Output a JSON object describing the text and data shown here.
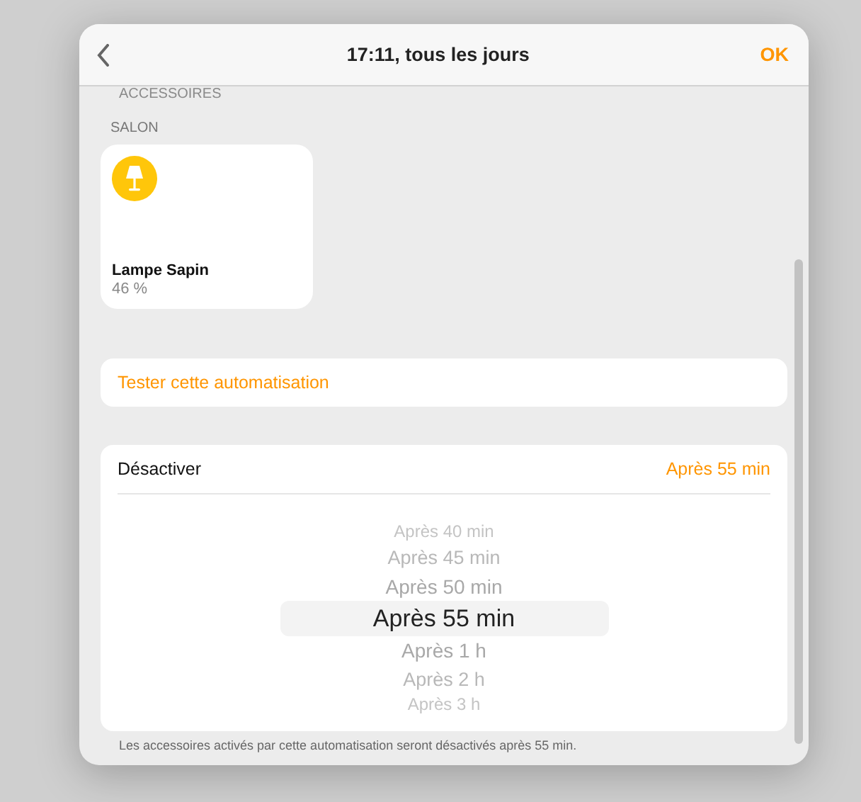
{
  "header": {
    "title": "17:11, tous les jours",
    "ok": "OK"
  },
  "section_label": "ACCESSOIRES",
  "room": "SALON",
  "accessories": [
    {
      "name": "Lampe Sapin",
      "status": "46 %",
      "on": true
    }
  ],
  "test_action": "Tester cette automatisation",
  "deactivate": {
    "label": "Désactiver",
    "value": "Après 55 min",
    "picker": [
      {
        "label": "Après 40 min",
        "selected": false
      },
      {
        "label": "Après 45 min",
        "selected": false
      },
      {
        "label": "Après 50 min",
        "selected": false
      },
      {
        "label": "Après 55 min",
        "selected": true
      },
      {
        "label": "Après 1 h",
        "selected": false
      },
      {
        "label": "Après 2 h",
        "selected": false
      },
      {
        "label": "Après 3 h",
        "selected": false
      }
    ],
    "footnote": "Les accessoires activés par cette automatisation seront désactivés après 55 min."
  }
}
